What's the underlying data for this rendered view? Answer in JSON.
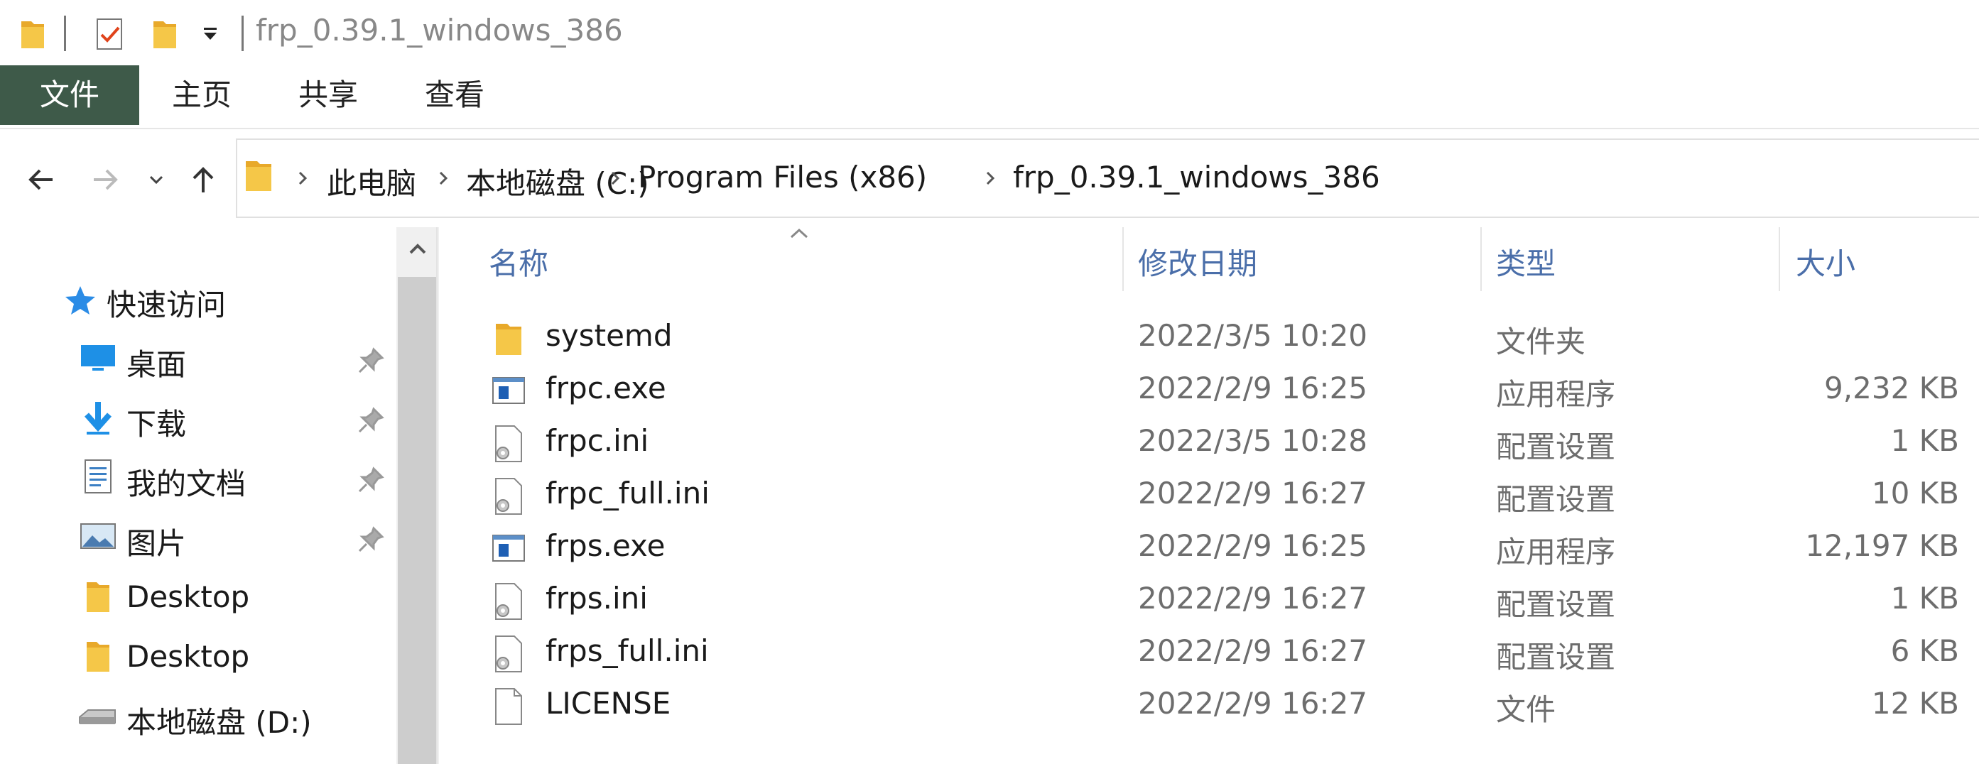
{
  "window": {
    "title": "frp_0.39.1_windows_386"
  },
  "quick_access_toolbar": [
    "folder-icon",
    "properties-icon",
    "new-folder-icon",
    "customize-dropdown"
  ],
  "ribbon": {
    "tabs": [
      {
        "label": "文件",
        "active": true
      },
      {
        "label": "主页",
        "active": false
      },
      {
        "label": "共享",
        "active": false
      },
      {
        "label": "查看",
        "active": false
      }
    ]
  },
  "address_bar": {
    "breadcrumbs": [
      "此电脑",
      "本地磁盘 (C:)",
      "Program Files (x86)",
      "frp_0.39.1_windows_386"
    ]
  },
  "sidebar": {
    "quick_access_label": "快速访问",
    "items": [
      {
        "label": "桌面",
        "icon": "desktop-icon",
        "pinned": true
      },
      {
        "label": "下载",
        "icon": "download-icon",
        "pinned": true
      },
      {
        "label": "我的文档",
        "icon": "documents-icon",
        "pinned": true
      },
      {
        "label": "图片",
        "icon": "pictures-icon",
        "pinned": true
      },
      {
        "label": "Desktop",
        "icon": "folder-icon",
        "pinned": false
      },
      {
        "label": "Desktop",
        "icon": "folder-icon",
        "pinned": false
      },
      {
        "label": "本地磁盘 (D:)",
        "icon": "drive-icon",
        "pinned": false
      }
    ]
  },
  "file_list": {
    "columns": {
      "name": "名称",
      "modified": "修改日期",
      "type": "类型",
      "size": "大小"
    },
    "sort_column": "name",
    "rows": [
      {
        "name": "systemd",
        "modified": "2022/3/5 10:20",
        "type": "文件夹",
        "size": "",
        "icon": "folder-icon"
      },
      {
        "name": "frpc.exe",
        "modified": "2022/2/9 16:25",
        "type": "应用程序",
        "size": "9,232 KB",
        "icon": "exe-icon"
      },
      {
        "name": "frpc.ini",
        "modified": "2022/3/5 10:28",
        "type": "配置设置",
        "size": "1 KB",
        "icon": "ini-icon"
      },
      {
        "name": "frpc_full.ini",
        "modified": "2022/2/9 16:27",
        "type": "配置设置",
        "size": "10 KB",
        "icon": "ini-icon"
      },
      {
        "name": "frps.exe",
        "modified": "2022/2/9 16:25",
        "type": "应用程序",
        "size": "12,197 KB",
        "icon": "exe-icon"
      },
      {
        "name": "frps.ini",
        "modified": "2022/2/9 16:27",
        "type": "配置设置",
        "size": "1 KB",
        "icon": "ini-icon"
      },
      {
        "name": "frps_full.ini",
        "modified": "2022/2/9 16:27",
        "type": "配置设置",
        "size": "6 KB",
        "icon": "ini-icon"
      },
      {
        "name": "LICENSE",
        "modified": "2022/2/9 16:27",
        "type": "文件",
        "size": "12 KB",
        "icon": "file-icon"
      }
    ]
  },
  "colors": {
    "accent_tab": "#3e5a49",
    "header_text": "#4a6ea9",
    "folder": "#f3c343"
  }
}
